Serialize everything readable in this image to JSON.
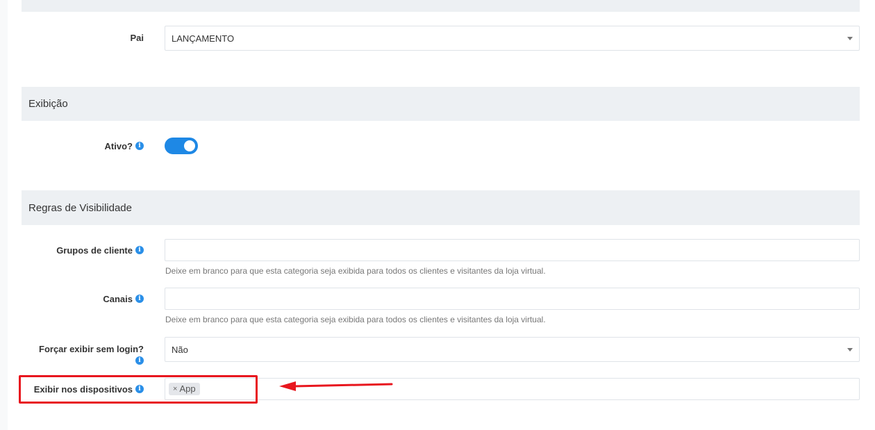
{
  "form": {
    "pai_label": "Pai",
    "pai_value": "LANÇAMENTO",
    "section_exibicao": "Exibição",
    "ativo_label": "Ativo?",
    "ativo_on": true,
    "section_regras": "Regras de Visibilidade",
    "grupos_label": "Grupos de cliente",
    "grupos_help": "Deixe em branco para que esta categoria seja exibida para todos os clientes e visitantes da loja virtual.",
    "canais_label": "Canais",
    "canais_help": "Deixe em branco para que esta categoria seja exibida para todos os clientes e visitantes da loja virtual.",
    "forcar_label": "Forçar exibir sem login?",
    "forcar_value": "Não",
    "dispositivos_label": "Exibir nos dispositivos",
    "dispositivos_tags": [
      "App"
    ]
  },
  "icons": {
    "info": "info-icon",
    "caret": "chevron-down-icon",
    "remove": "close-icon"
  },
  "colors": {
    "accent": "#1e88e5",
    "section_bg": "#edf0f3",
    "annotation": "#e8161e"
  }
}
